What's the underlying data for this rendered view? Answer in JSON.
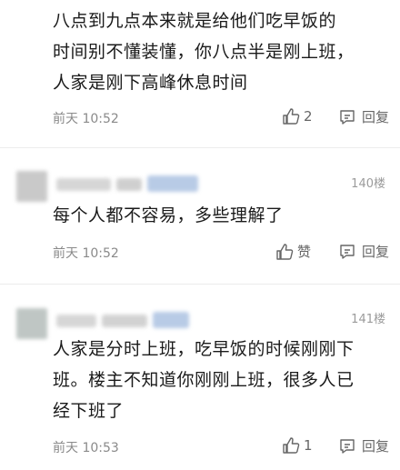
{
  "comments": [
    {
      "text": "八点到九点本来就是给他们吃早饭的时间别不懂装懂，你八点半是刚上班，人家是刚下高峰休息时间",
      "lines": [
        "八点到九点本来就是给他们吃早饭的",
        "时间别不懂装懂，你八点半是刚上班，",
        "人家是刚下高峰休息时间"
      ],
      "time": "前天 10:52",
      "likes": "2",
      "reply_label": "回复"
    },
    {
      "floor": "140楼",
      "lines": [
        "每个人都不容易，多些理解了"
      ],
      "time": "前天 10:52",
      "likes": "赞",
      "reply_label": "回复"
    },
    {
      "floor": "141楼",
      "lines": [
        "人家是分时上班，吃早饭的时候刚刚下",
        "班。楼主不知道你刚刚上班，很多人已",
        "经下班了"
      ],
      "time": "前天 10:53",
      "likes": "1",
      "reply_label": "回复"
    }
  ],
  "colors": {
    "meta": "#8a8a8a",
    "divider": "#ececec",
    "blur_blue": "#b8cbe6"
  },
  "icons": [
    "thumbs-up-icon",
    "reply-icon"
  ]
}
